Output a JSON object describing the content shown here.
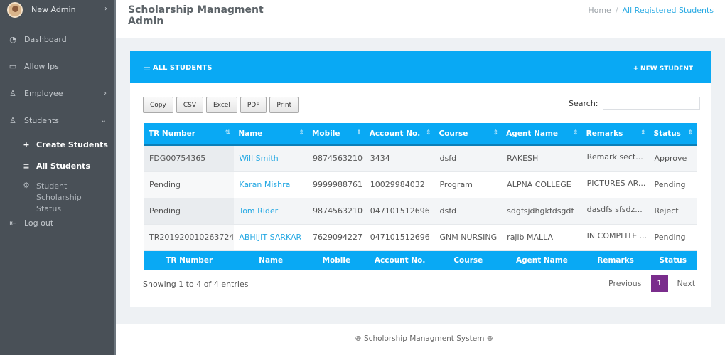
{
  "sidebar": {
    "user_name": "New Admin",
    "items": [
      {
        "label": "Dashboard",
        "icon": "dashboard-icon"
      },
      {
        "label": "Allow Ips",
        "icon": "monitor-icon"
      },
      {
        "label": "Employee",
        "icon": "user-icon"
      },
      {
        "label": "Students",
        "icon": "user-icon"
      }
    ],
    "sub_items": [
      {
        "label": "Create Students",
        "icon": "plus-icon"
      },
      {
        "label": "All Students",
        "icon": "list-icon"
      },
      {
        "label": "Student Scholarship Status",
        "icon": "gear-icon"
      }
    ],
    "logout_label": "Log out"
  },
  "header": {
    "title": "Scholarship Managment Admin",
    "breadcrumb": {
      "home": "Home",
      "sep": "/",
      "current": "All Registered Students"
    }
  },
  "card": {
    "title": "ALL STUDENTS",
    "new_button": "NEW STUDENT"
  },
  "export_buttons": [
    "Copy",
    "CSV",
    "Excel",
    "PDF",
    "Print"
  ],
  "search": {
    "label": "Search:",
    "value": ""
  },
  "table": {
    "columns": [
      "TR Number",
      "Name",
      "Mobile",
      "Account No.",
      "Course",
      "Agent Name",
      "Remarks",
      "Status"
    ],
    "rows": [
      [
        "FDG00754365",
        "Will Smith",
        "9874563210",
        "3434",
        "dsfd",
        "RAKESH",
        "Remark sect...",
        "Approve"
      ],
      [
        "Pending",
        "Karan Mishra",
        "9999988761",
        "10029984032",
        "Program",
        "ALPNA COLLEGE",
        "PICTURES AR...",
        "Pending"
      ],
      [
        "Pending",
        "Tom Rider",
        "9874563210",
        "047101512696",
        "dsfd",
        "sdgfsjdhgkfdsgdf",
        "dasdfs sfsdz...",
        "Reject"
      ],
      [
        "TR201920010263724",
        "ABHIJIT SARKAR",
        "7629094227",
        "047101512696",
        "GNM NURSING",
        "rajib MALLA",
        "IN COMPLITE ...",
        "Pending"
      ]
    ]
  },
  "pagination": {
    "info": "Showing 1 to 4 of 4 entries",
    "previous": "Previous",
    "page": "1",
    "next": "Next"
  },
  "footer": {
    "text": "Scholorship Managment System"
  },
  "colors": {
    "accent": "#09a9f4",
    "sidebar": "#495057",
    "active_page": "#7a2d8c",
    "link": "#27a9e3"
  }
}
